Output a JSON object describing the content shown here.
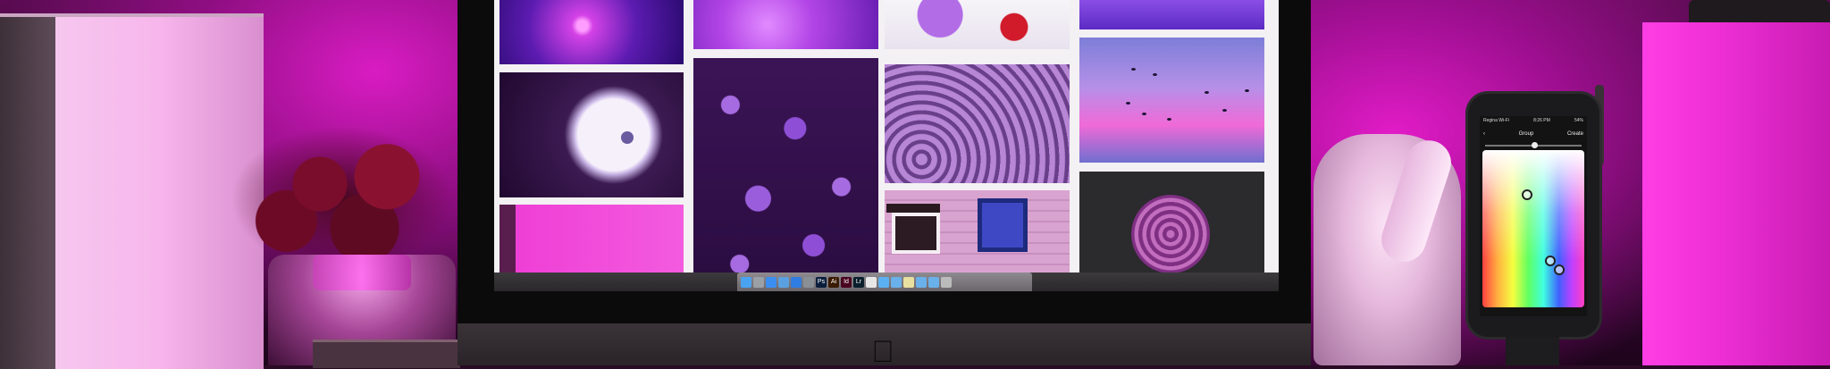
{
  "scene": {
    "description_label": "",
    "accent": "#e21cc7"
  },
  "monitor": {
    "logo_glyph": ""
  },
  "dock": {
    "icons": [
      {
        "name": "finder-icon",
        "glyph": "",
        "color": "#4aa3f0"
      },
      {
        "name": "launchpad-icon",
        "glyph": "",
        "color": "#9aa0a6"
      },
      {
        "name": "safari-icon",
        "glyph": "",
        "color": "#3b8ef0"
      },
      {
        "name": "mail-icon",
        "glyph": "",
        "color": "#5aa0e0"
      },
      {
        "name": "app-store-icon",
        "glyph": "",
        "color": "#2f7de0"
      },
      {
        "name": "system-icon",
        "glyph": "",
        "color": "#8a8f96"
      },
      {
        "name": "photoshop-icon",
        "glyph": "Ps",
        "color": "#0a1e3c"
      },
      {
        "name": "illustrator-icon",
        "glyph": "Ai",
        "color": "#3a1a00"
      },
      {
        "name": "indesign-icon",
        "glyph": "Id",
        "color": "#49021f"
      },
      {
        "name": "lightroom-icon",
        "glyph": "Lr",
        "color": "#0a1e2c"
      },
      {
        "name": "chrome-icon",
        "glyph": "",
        "color": "#e6e6e6"
      },
      {
        "name": "cloud-icon",
        "glyph": "",
        "color": "#5ab0f0"
      },
      {
        "name": "folder-icon",
        "glyph": "",
        "color": "#6ab0ea"
      },
      {
        "name": "notes-icon",
        "glyph": "",
        "color": "#e8e0a0"
      },
      {
        "name": "folder-icon",
        "glyph": "",
        "color": "#6ab0ea"
      },
      {
        "name": "folder-icon",
        "glyph": "",
        "color": "#6ab0ea"
      },
      {
        "name": "trash-icon",
        "glyph": "",
        "color": "#bbbbbb"
      }
    ]
  },
  "phone": {
    "status_carrier": "Regina Wi-Fi",
    "status_time": "8:26 PM",
    "status_battery": "54%",
    "appbar_left": "‹",
    "appbar_title": "Group",
    "appbar_right": "Create"
  }
}
